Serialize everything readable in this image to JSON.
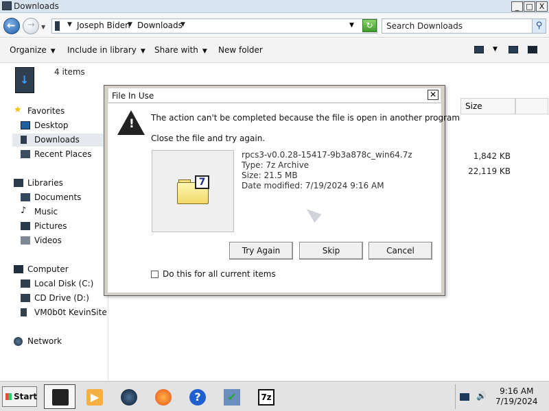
{
  "window": {
    "title": "Downloads",
    "minimize": "_",
    "maximize": "□",
    "close": "X"
  },
  "address": {
    "crumbs": [
      "Joseph Biden",
      "Downloads"
    ],
    "search_placeholder": "Search Downloads"
  },
  "toolbar": {
    "organize": "Organize",
    "include_in_library": "Include in library",
    "share_with": "Share with",
    "new_folder": "New folder"
  },
  "details": {
    "items_count": "4 items"
  },
  "nav": {
    "favorites": "Favorites",
    "desktop": "Desktop",
    "downloads": "Downloads",
    "recent_places": "Recent Places",
    "libraries": "Libraries",
    "documents": "Documents",
    "music": "Music",
    "pictures": "Pictures",
    "videos": "Videos",
    "computer": "Computer",
    "local_disk": "Local Disk (C:)",
    "cd_drive": "CD Drive (D:)",
    "network_share": "VM0b0t KevinSite",
    "network": "Network"
  },
  "filelist": {
    "size_header": "Size",
    "sizes": [
      "1,842 KB",
      "22,119 KB"
    ]
  },
  "dialog": {
    "title": "File In Use",
    "close_glyph": "✕",
    "message": "The action can't be completed because the file is open in another program",
    "instruction": "Close the file and try again.",
    "file_name": "rpcs3-v0.0.28-15417-9b3a878c_win64.7z",
    "file_type": "Type: 7z Archive",
    "file_size": "Size: 21.5 MB",
    "file_modified": "Date modified: 7/19/2024 9:16 AM",
    "try_again": "Try Again",
    "skip": "Skip",
    "cancel": "Cancel",
    "checkbox_label": "Do this for all current items",
    "checkbox_checked": false
  },
  "taskbar": {
    "start": "Start",
    "time": "9:16 AM",
    "date": "7/19/2024"
  },
  "icons": {
    "sevenzip_glyph": "7",
    "sevenzip_task": "7z"
  }
}
